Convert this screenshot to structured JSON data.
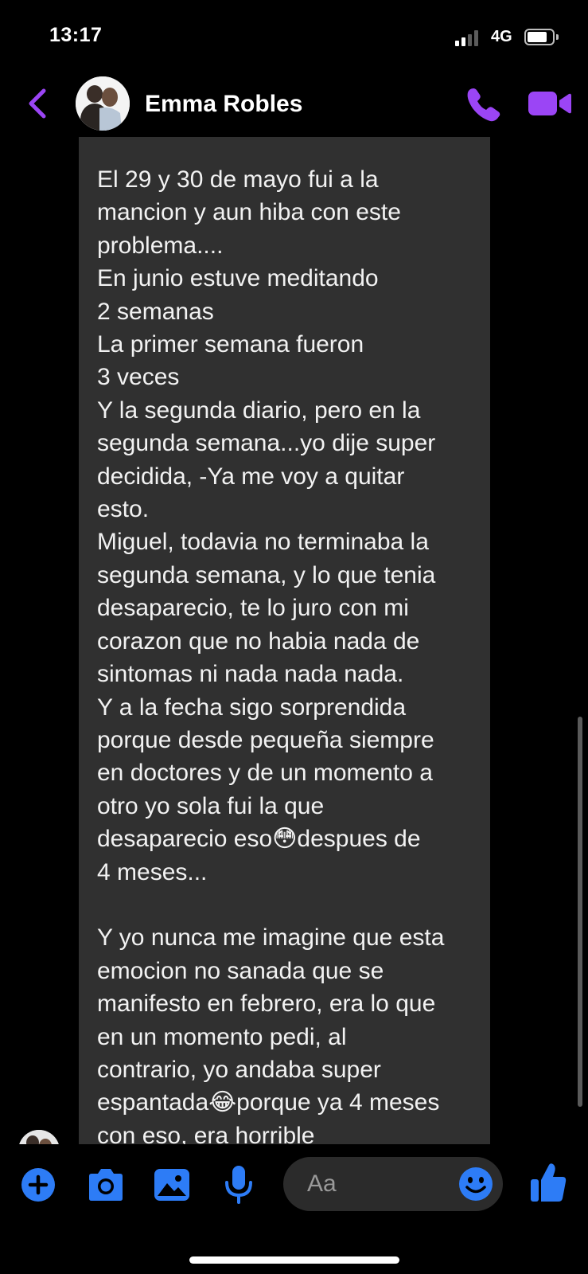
{
  "status_bar": {
    "time": "13:17",
    "network": "4G"
  },
  "header": {
    "contact_name": "Emma Robles",
    "accent_color": "#9B45F5"
  },
  "message": {
    "text": "El 29 y 30 de mayo fui a la\nmancion y aun hiba con este\nproblema....\nEn junio estuve meditando\n2 semanas\nLa primer semana fueron\n3 veces\nY la segunda diario, pero en la\nsegunda semana...yo dije super\ndecidida, -Ya me voy a quitar\nesto.\nMiguel, todavia no terminaba la\nsegunda semana, y lo que tenia\ndesaparecio, te lo juro con mi\ncorazon que no habia nada de\nsintomas ni nada nada nada.\nY a la fecha sigo sorprendida\nporque desde pequeña siempre\nen doctores y de un momento a\notro yo sola fui la que\ndesaparecio eso😳despues de\n4 meses...\n\nY yo nunca me imagine que esta\nemocion no sanada que se\nmanifesto en febrero, era lo que\nen un momento pedi, al\ncontrario, yo andaba super\nespantada😂porque ya 4 meses\ncon eso, era horrible",
    "bubble_color": "#303030"
  },
  "composer": {
    "placeholder": "Aa",
    "accent_color": "#2D7CF6"
  },
  "icons": {
    "back": "chevron-left-icon",
    "call": "phone-icon",
    "video": "video-camera-icon",
    "plus": "plus-icon",
    "camera": "camera-icon",
    "gallery": "image-icon",
    "mic": "microphone-icon",
    "emoji": "smiley-icon",
    "like": "thumbs-up-icon"
  }
}
